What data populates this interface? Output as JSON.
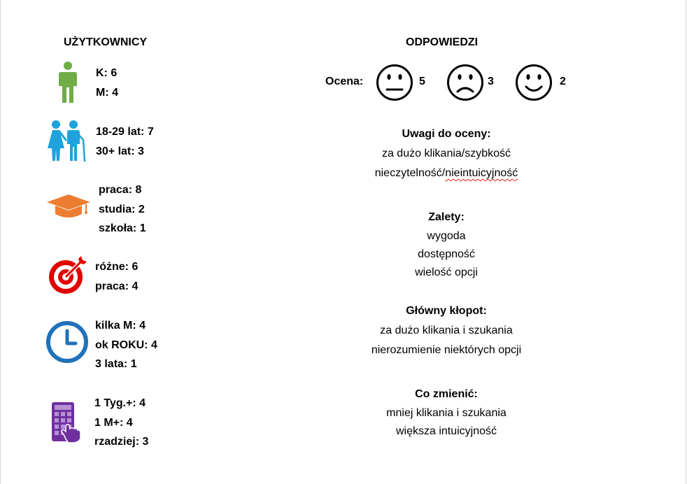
{
  "users": {
    "title": "UŻYTKOWNICY",
    "groups": [
      {
        "icon": "person-icon",
        "color": "#70ad47",
        "lines": [
          "K: 6",
          "M: 4"
        ]
      },
      {
        "icon": "couple-icon",
        "color": "#1ea3dc",
        "lines": [
          "18-29 lat: 7",
          "30+ lat: 3"
        ]
      },
      {
        "icon": "graduation-cap-icon",
        "color": "#ed7d31",
        "lines": [
          "praca: 8",
          "studia: 2",
          "szkoła: 1"
        ]
      },
      {
        "icon": "target-icon",
        "color": "#e00000",
        "lines": [
          "różne: 6",
          "praca: 4"
        ]
      },
      {
        "icon": "clock-icon",
        "color": "#1f72b8",
        "lines": [
          "kilka M: 4",
          "ok ROKU: 4",
          "3 lata: 1"
        ]
      },
      {
        "icon": "calendar-touch-icon",
        "color": "#7030a0",
        "lines": [
          "1 Tyg.+: 4",
          "1 M+: 4",
          "rzadziej: 3"
        ]
      }
    ]
  },
  "answers": {
    "title": "ODPOWIEDZI",
    "rating": {
      "label": "Ocena:",
      "items": [
        {
          "icon": "neutral-face-icon",
          "count": "5"
        },
        {
          "icon": "sad-face-icon",
          "count": "3"
        },
        {
          "icon": "happy-face-icon",
          "count": "2"
        }
      ]
    },
    "remarks": {
      "heading": "Uwagi do oceny:",
      "lines": [
        "za dużo klikania/szybkość"
      ],
      "line2_prefix": "nieczytelność/",
      "line2_marked": "nieintuicyjność"
    },
    "advantages": {
      "heading": "Zalety:",
      "lines": [
        "wygoda",
        "dostępność",
        "wielość opcji"
      ]
    },
    "main_problem": {
      "heading": "Główny kłopot:",
      "lines": [
        "za dużo klikania i szukania",
        "nierozumienie niektórych opcji"
      ]
    },
    "what_to_change": {
      "heading": "Co zmienić:",
      "lines": [
        "mniej klikania i szukania",
        "większa intuicyjność"
      ]
    }
  }
}
